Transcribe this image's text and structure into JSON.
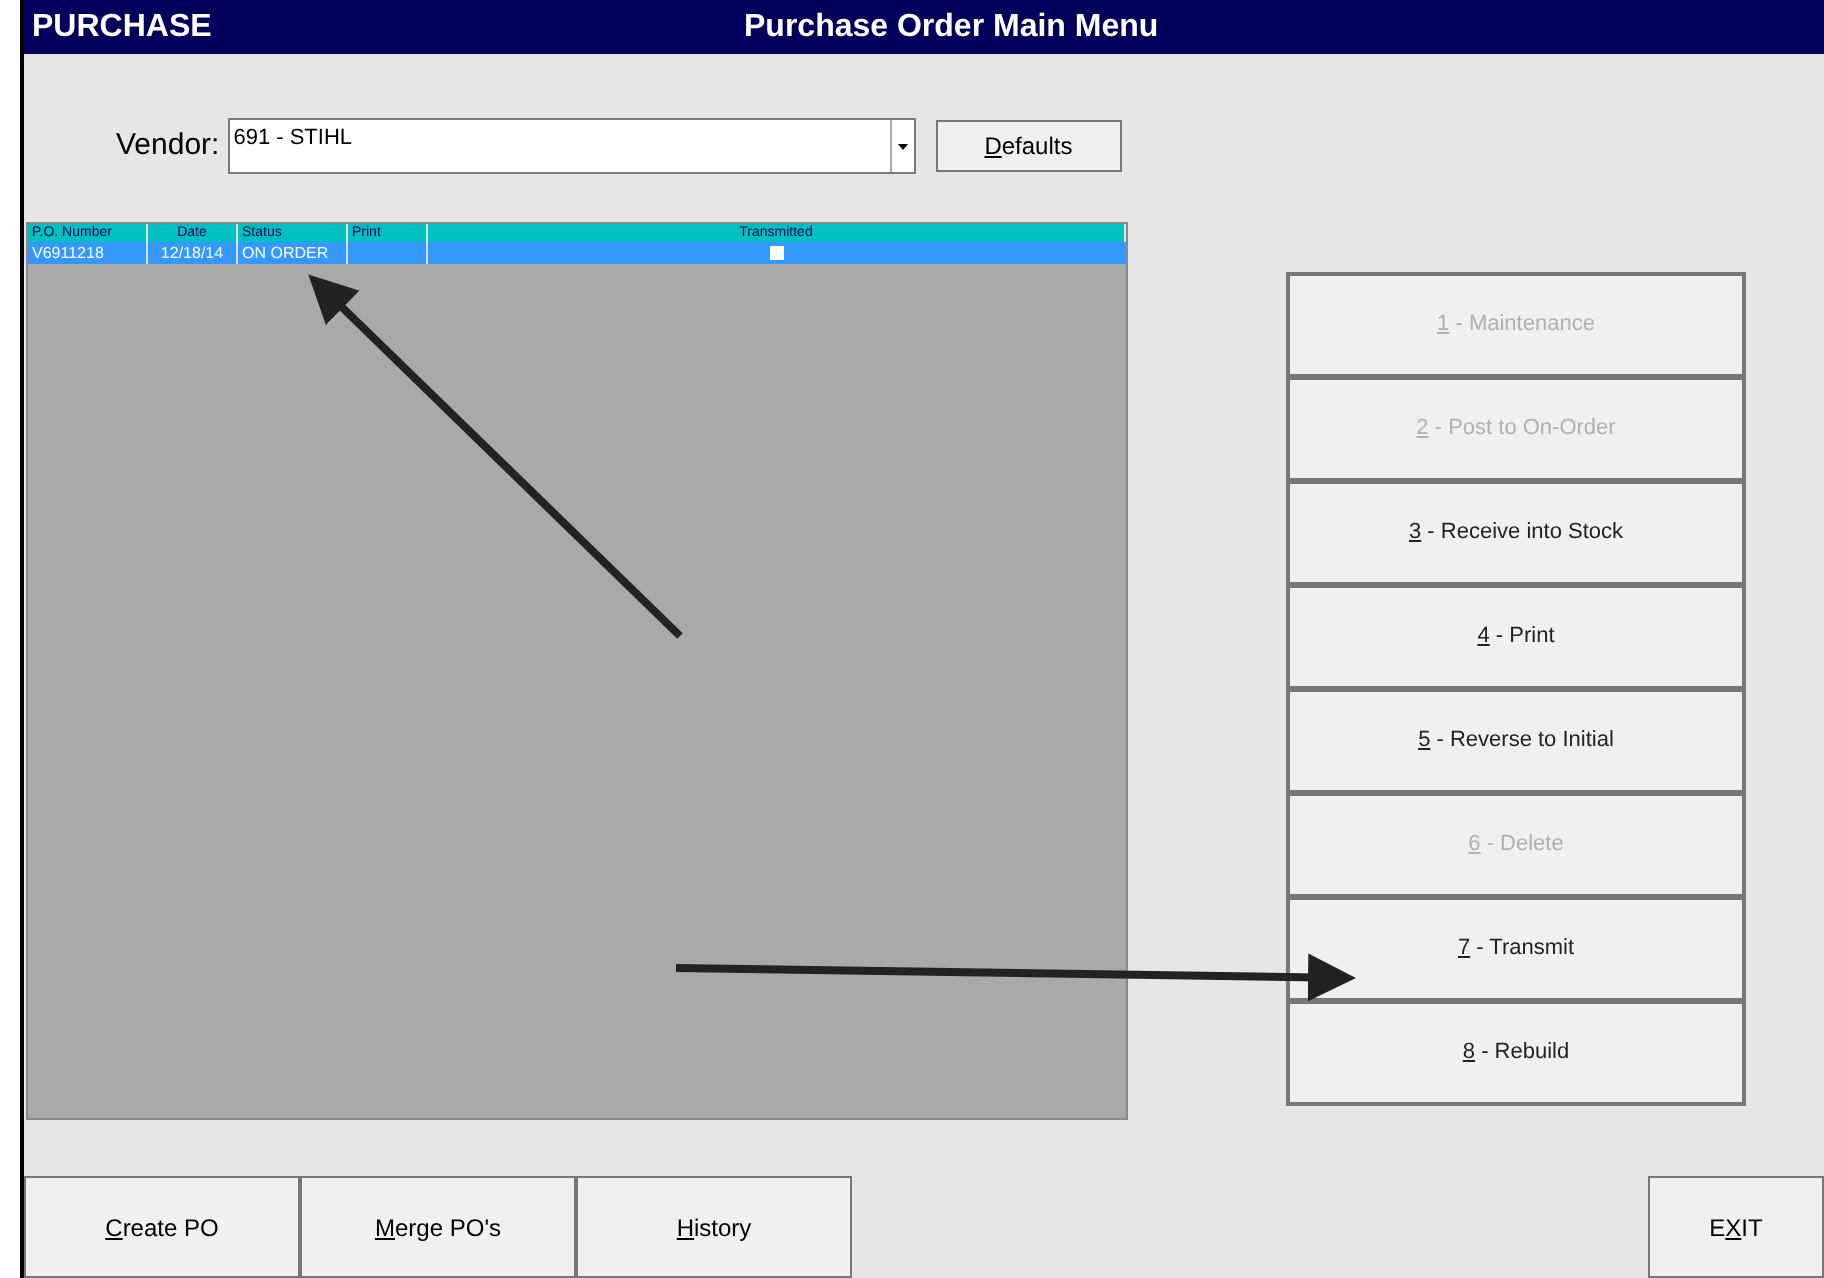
{
  "window": {
    "app_label": "PURCHASE",
    "title": "Purchase Order Main Menu"
  },
  "vendor": {
    "label": "Vendor:",
    "value": "691 - STIHL"
  },
  "defaults_button": {
    "hotkey": "D",
    "rest": "efaults"
  },
  "table": {
    "columns": [
      "P.O. Number",
      "Date",
      "Status",
      "Print",
      "Transmitted"
    ],
    "rows": [
      {
        "po_number": "V6911218",
        "date": "12/18/14",
        "status": "ON ORDER",
        "transmitted": false,
        "selected": true
      }
    ]
  },
  "menu": [
    {
      "hotkey": "1",
      "rest": " - Maintenance",
      "disabled": true
    },
    {
      "hotkey": "2",
      "rest": " - Post to On-Order",
      "disabled": true
    },
    {
      "hotkey": "3",
      "rest": " - Receive into Stock",
      "disabled": false
    },
    {
      "hotkey": "4",
      "rest": " - Print",
      "disabled": false
    },
    {
      "hotkey": "5",
      "rest": " - Reverse to Initial",
      "disabled": false
    },
    {
      "hotkey": "6",
      "rest": " - Delete",
      "disabled": true
    },
    {
      "hotkey": "7",
      "rest": " - Transmit",
      "disabled": false
    },
    {
      "hotkey": "8",
      "rest": " - Rebuild",
      "disabled": false
    }
  ],
  "bottom_buttons": [
    {
      "hotkey": "C",
      "rest": "reate PO"
    },
    {
      "hotkey": "M",
      "rest": "erge PO's"
    },
    {
      "hotkey": "H",
      "rest": "istory"
    }
  ],
  "exit_button": {
    "before": "E",
    "hotkey": "X",
    "rest": "IT"
  }
}
